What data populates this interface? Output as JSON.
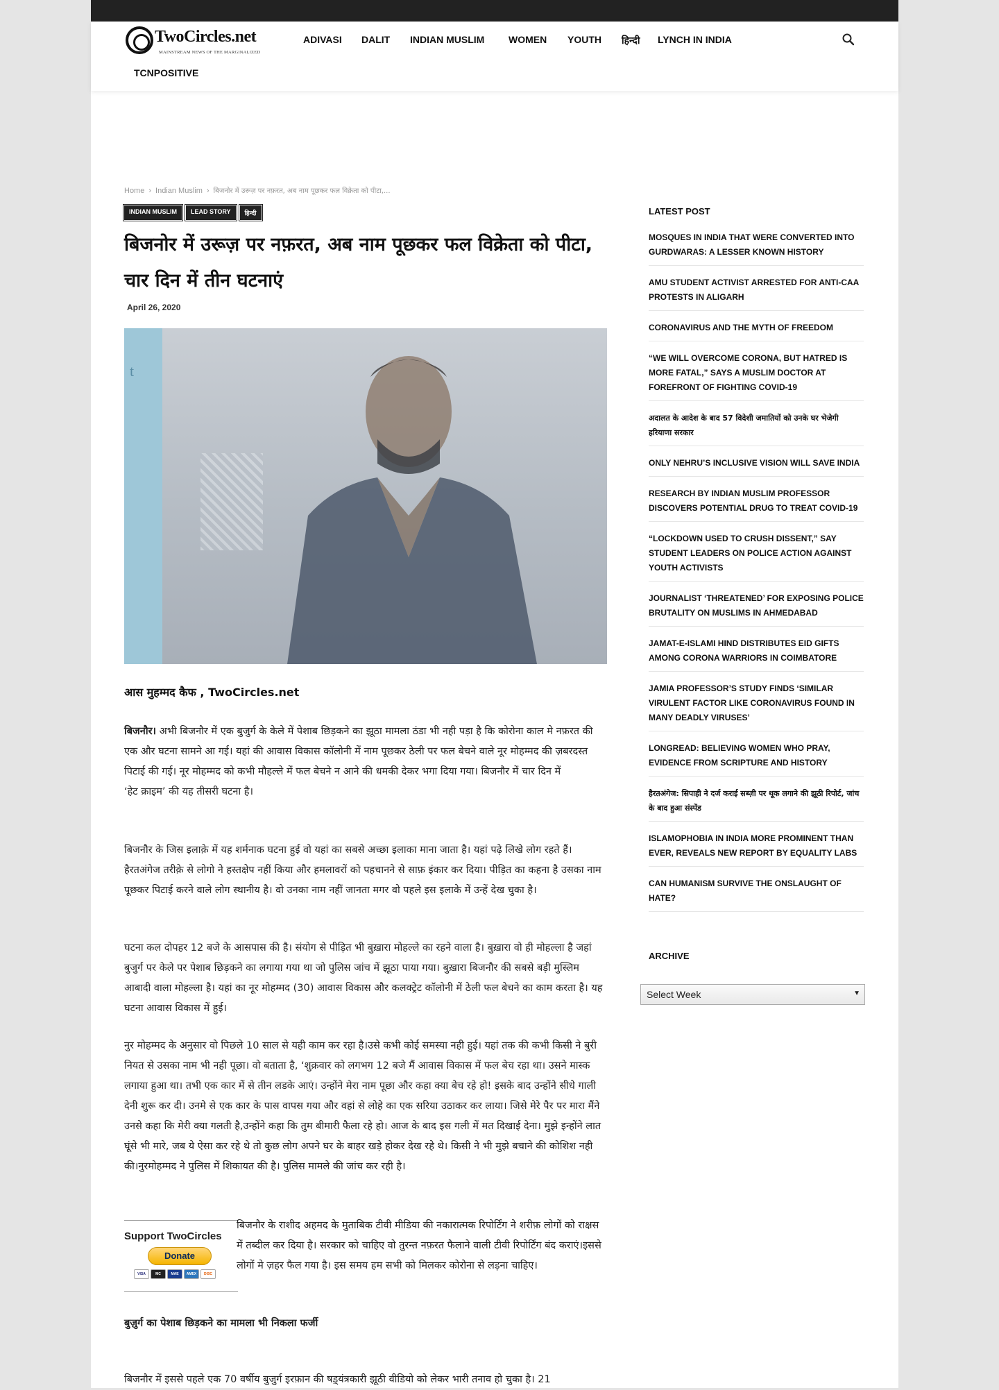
{
  "site": {
    "logo_text": "TwoCircles.net",
    "logo_tagline": "MAINSTREAM NEWS OF THE MARGINALIZED"
  },
  "nav": {
    "items": [
      "ADIVASI",
      "DALIT",
      "INDIAN MUSLIM",
      "WOMEN",
      "YOUTH",
      "हिन्दी",
      "LYNCH IN INDIA",
      "TCNPOSITIVE"
    ]
  },
  "breadcrumb": {
    "home": "Home",
    "category": "Indian Muslim",
    "current": "बिजनोर में उरूज़ पर नफ़रत, अब नाम पूछकर फल विक्रेता को पीटा,..."
  },
  "article": {
    "tags": [
      "INDIAN MUSLIM",
      "LEAD STORY",
      "हिन्दी"
    ],
    "title": "बिजनोर में उरूज़ पर नफ़रत, अब नाम पूछकर फल विक्रेता को पीटा, चार दिन में तीन घटनाएं",
    "date": "April 26, 2020",
    "hero_sign_text": "t",
    "byline": "आस मुहम्मद कैफ , TwoCircles.net",
    "p1_lead": "बिजनौर।",
    "p1_rest": " अभी बिजनौर में एक बुजुर्ग के केले में पेशाब छिड़कने का झूठा मामला ठंडा भी नही पड़ा है कि कोरोना काल मे नफ़रत की एक और घटना सामने आ गई। यहां की आवास विकास कॉलोनी में नाम पूछकर ठेली पर फल बेचने वाले नूर मोहम्मद की ज़बरदस्त पिटाई की गई। नूर मोहम्मद को कभी मौहल्ले में फल बेचने न आने की धमकी देकर भगा दिया गया। बिजनौर में चार दिन में",
    "p1_tail": "‘हेट क्राइम’ की यह तीसरी घटना है।",
    "p2": "बिजनौर के जिस इलाक़े में यह शर्मनाक घटना हुई वो यहां का सबसे अच्छा इलाका माना जाता है। यहां पढ़े लिखे लोग रहते हैं। हैरतअंगेज तरीक़े से लोगो ने हस्तक्षेप नहीं किया और हमलावरों को पहचानने से साफ़ इंकार कर दिया। पीड़ित का कहना है उसका नाम पूछकर पिटाई करने वाले लोग स्थानीय है। वो उनका नाम नहीं जानता मगर वो पहले इस इलाके में उन्हें देख चुका है।",
    "p3": "घटना कल दोपहर 12 बजे के आसपास की है। संयोग से पीड़ित भी बुख़ारा मोहल्ले का रहने वाला है। बुख़ारा वो ही मोहल्ला है जहां  बुजुर्ग पर केले पर पेशाब छिड़कने का लगाया गया था जो पुलिस जांच में झूठा पाया गया। बुख़ारा बिजनौर की सबसे बड़ी मुस्लिम आबादी वाला मोहल्ला है। यहां का नूर मोहम्मद (30) आवास विकास और कलक्ट्रेट कॉलोनी में ठेली फल बेचने का काम करता है। यह घटना आवास विकास में हुई।",
    "p4": "नुर मोहम्मद के अनुसार वो पिछले 10 साल से यही काम कर रहा है।उसे कभी कोई समस्या नही हुई। यहां तक की कभी किसी ने बुरी नियत से उसका नाम भी नही पूछा। वो बताता है, ‘शुक्रवार को लगभग 12 बजे मैं आवास विकास में फल बेच रहा था। उसने मास्क लगाया हुआ था। तभी एक कार में से तीन लडके आएं। उन्होंने मेरा नाम पूछा और कहा क्या बेच रहे हो! इसके बाद उन्होंने सीधे गाली देनी शुरू कर दी। उनमे से एक कार के पास वापस गया और वहां से लोहे का एक सरिया उठाकर कर लाया। जिसे मेरे पैर पर मारा मैंने उनसे कहा कि मेरी क्या गलती है,उन्होंने कहा कि तुम बीमारी फैला रहे हो। आज के बाद इस गली में मत दिखाई देना। मुझे इन्होंने लात घूंसे भी मारे, जब ये ऐसा कर रहे थे तो कुछ लोग अपने घर के बाहर खड़े होकर देख रहे थे। किसी ने भी मुझे बचाने की कोशिश नही की।नुरमोहम्मद ने पुलिस में शिकायत की है। पुलिस मामले की जांच कर रही है।",
    "p5": "बिजनौर के राशीद अहमद के मुताबिक टीवी मीडिया की नकारात्मक रिपोर्टिंग ने शरीफ़ लोगों को राक्षस में तब्दील कर दिया है। सरकार को चाहिए वो तुरन्त नफ़रत फैलाने वाली टीवी रिपोर्टिंग बंद कराएं।इससे लोगों मे ज़हर फैल गया है। इस समय हम सभी को मिलकर कोरोना से लड़ना चाहिए।",
    "subheading": "बुज़ुर्ग का पेशाब छिड़कने का मामला भी निकला फर्जी",
    "p6": "बिजनौर में इससे पहले एक 70 वर्षीय बुजुर्ग इरफ़ान की षड़्यंत्रकारी झूठी वीडियो को लेकर भारी तनाव हो चुका है। 21"
  },
  "support": {
    "title": "Support TwoCircles",
    "donate_label": "Donate",
    "cards": [
      "VISA",
      "MC",
      "MAE",
      "AMEX",
      "DISC"
    ]
  },
  "sidebar": {
    "latest_heading": "LATEST POST",
    "posts": [
      {
        "text": "MOSQUES IN INDIA THAT WERE CONVERTED INTO GURDWARAS: A LESSER KNOWN HISTORY",
        "hindi": false
      },
      {
        "text": "AMU STUDENT ACTIVIST ARRESTED FOR ANTI-CAA PROTESTS IN ALIGARH",
        "hindi": false
      },
      {
        "text": "CORONAVIRUS AND THE MYTH OF FREEDOM",
        "hindi": false
      },
      {
        "text": "“WE WILL OVERCOME CORONA, BUT HATRED IS MORE FATAL,” SAYS A MUSLIM DOCTOR AT FOREFRONT OF FIGHTING COVID-19",
        "hindi": false
      },
      {
        "text": "अदालत के आदेश के बाद 57 विदेशी जमातियों को उनके घर भेजेगी हरियाणा सरकार",
        "hindi": true
      },
      {
        "text": "ONLY NEHRU’S INCLUSIVE VISION WILL SAVE INDIA",
        "hindi": false
      },
      {
        "text": "RESEARCH BY INDIAN MUSLIM PROFESSOR DISCOVERS POTENTIAL DRUG TO TREAT COVID-19",
        "hindi": false
      },
      {
        "text": "“LOCKDOWN USED TO CRUSH DISSENT,” SAY STUDENT LEADERS ON POLICE ACTION AGAINST YOUTH ACTIVISTS",
        "hindi": false
      },
      {
        "text": "JOURNALIST ‘THREATENED’ FOR EXPOSING POLICE BRUTALITY ON MUSLIMS IN AHMEDABAD",
        "hindi": false
      },
      {
        "text": "JAMAT-E-ISLAMI HIND DISTRIBUTES EID GIFTS AMONG CORONA WARRIORS IN COIMBATORE",
        "hindi": false
      },
      {
        "text": "JAMIA PROFESSOR’S STUDY FINDS ‘SIMILAR VIRULENT FACTOR LIKE CORONAVIRUS FOUND IN MANY DEADLY VIRUSES’",
        "hindi": false
      },
      {
        "text": "LONGREAD: BELIEVING WOMEN WHO PRAY, EVIDENCE FROM SCRIPTURE AND HISTORY",
        "hindi": false
      },
      {
        "text": "हैरतअंगेज: सिपाही ने दर्ज कराई सब्ज़ी पर थूक लगाने की झूठी रिपोर्ट, जांच के बाद हुआ संस्पेंड",
        "hindi": true
      },
      {
        "text": "ISLAMOPHOBIA IN INDIA MORE PROMINENT THAN EVER, REVEALS NEW REPORT BY EQUALITY LABS",
        "hindi": false
      },
      {
        "text": "CAN HUMANISM SURVIVE THE ONSLAUGHT OF HATE?",
        "hindi": false
      }
    ],
    "archive_heading": "ARCHIVE",
    "archive_select_value": "Select Week"
  },
  "colors": {
    "topbar": "#222222",
    "tag_bg": "#222222",
    "donate_gold": "#f5b500"
  },
  "icons": {
    "search": "search-icon"
  }
}
